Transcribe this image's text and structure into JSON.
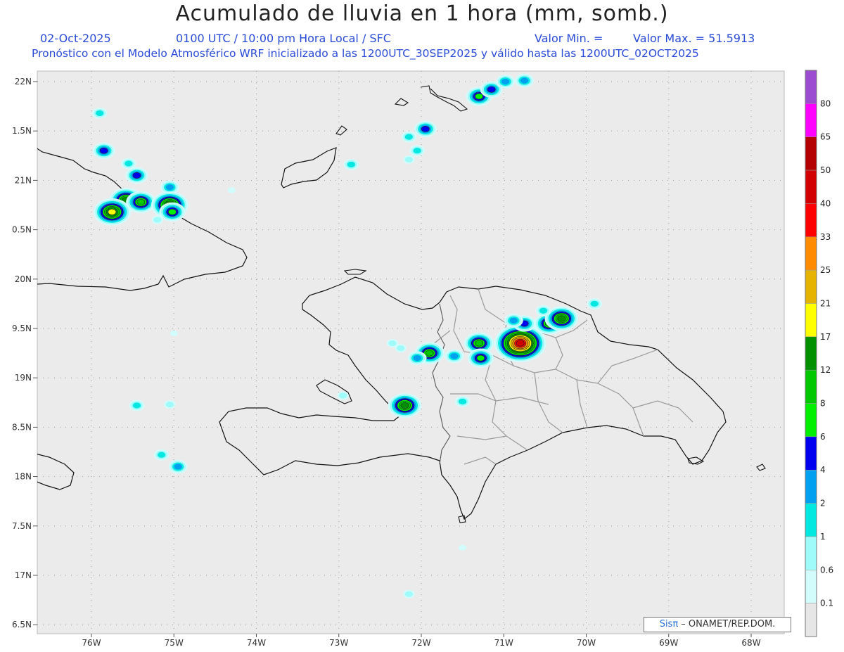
{
  "title": "Acumulado de lluvia en 1 hora (mm, somb.)",
  "date": "02-Oct-2025",
  "time_label": "0100 UTC / 10:00 pm Hora Local / SFC",
  "valor_min_label": "Valor Min. =",
  "valor_max_label": "Valor Max. = 51.5913",
  "forecast_line": "Pronóstico con el Modelo Atmosférico WRF inicializado a las 1200UTC_30SEP2025 y válido hasta las  1200UTC_02OCT2025",
  "credit_brand": "Sisπ",
  "credit_text": " – ONAMET/REP.DOM.",
  "lat_labels": [
    {
      "value": 22.0,
      "label": "22N"
    },
    {
      "value": 21.5,
      "label": "1.5N"
    },
    {
      "value": 21.0,
      "label": "21N"
    },
    {
      "value": 20.5,
      "label": "0.5N"
    },
    {
      "value": 20.0,
      "label": "20N"
    },
    {
      "value": 19.5,
      "label": "9.5N"
    },
    {
      "value": 19.0,
      "label": "19N"
    },
    {
      "value": 18.5,
      "label": "8.5N"
    },
    {
      "value": 18.0,
      "label": "18N"
    },
    {
      "value": 17.5,
      "label": "7.5N"
    },
    {
      "value": 17.0,
      "label": "17N"
    },
    {
      "value": 16.5,
      "label": "6.5N"
    }
  ],
  "lon_labels": [
    {
      "value": -76,
      "label": "76W"
    },
    {
      "value": -75,
      "label": "75W"
    },
    {
      "value": -74,
      "label": "74W"
    },
    {
      "value": -73,
      "label": "73W"
    },
    {
      "value": -72,
      "label": "72W"
    },
    {
      "value": -71,
      "label": "71W"
    },
    {
      "value": -70,
      "label": "70W"
    },
    {
      "value": -69,
      "label": "69W"
    },
    {
      "value": -68,
      "label": "68W"
    }
  ],
  "colorbar": [
    {
      "label": "",
      "color": "#e6e6e6"
    },
    {
      "label": "0.1",
      "color": "#d2fcfc"
    },
    {
      "label": "0.6",
      "color": "#9ffafa"
    },
    {
      "label": "1",
      "color": "#00e8e0"
    },
    {
      "label": "2",
      "color": "#00a0f0"
    },
    {
      "label": "4",
      "color": "#0000f0"
    },
    {
      "label": "6",
      "color": "#00f000"
    },
    {
      "label": "8",
      "color": "#00c800"
    },
    {
      "label": "12",
      "color": "#009000"
    },
    {
      "label": "17",
      "color": "#ffff00"
    },
    {
      "label": "21",
      "color": "#e6b400"
    },
    {
      "label": "25",
      "color": "#ff8c00"
    },
    {
      "label": "33",
      "color": "#ff0000"
    },
    {
      "label": "40",
      "color": "#d20000"
    },
    {
      "label": "50",
      "color": "#b40000"
    },
    {
      "label": "65",
      "color": "#ff00ff"
    },
    {
      "label": "80",
      "color": "#9c4cd0"
    }
  ],
  "colors": {
    "sea": "#ebebeb",
    "coast": "#111111",
    "borders": "#9a9a9a",
    "subtitle": "#2a4bd7"
  },
  "rain_cells": [
    {
      "lon": -75.9,
      "lat": 21.68,
      "level": 3
    },
    {
      "lon": -75.85,
      "lat": 21.3,
      "level": 5
    },
    {
      "lon": -75.55,
      "lat": 21.17,
      "level": 3
    },
    {
      "lon": -75.45,
      "lat": 21.05,
      "level": 5
    },
    {
      "lon": -75.58,
      "lat": 20.8,
      "level": 8
    },
    {
      "lon": -75.75,
      "lat": 20.68,
      "level": 9
    },
    {
      "lon": -75.4,
      "lat": 20.78,
      "level": 7
    },
    {
      "lon": -75.05,
      "lat": 20.93,
      "level": 4
    },
    {
      "lon": -75.05,
      "lat": 20.75,
      "level": 9
    },
    {
      "lon": -75.02,
      "lat": 20.68,
      "level": 6
    },
    {
      "lon": -75.2,
      "lat": 20.6,
      "level": 2
    },
    {
      "lon": -74.3,
      "lat": 20.9,
      "level": 1
    },
    {
      "lon": -71.3,
      "lat": 21.85,
      "level": 6
    },
    {
      "lon": -71.15,
      "lat": 21.92,
      "level": 5
    },
    {
      "lon": -70.98,
      "lat": 22.0,
      "level": 4
    },
    {
      "lon": -70.75,
      "lat": 22.01,
      "level": 4
    },
    {
      "lon": -71.95,
      "lat": 21.52,
      "level": 5
    },
    {
      "lon": -72.15,
      "lat": 21.44,
      "level": 3
    },
    {
      "lon": -72.05,
      "lat": 21.3,
      "level": 3
    },
    {
      "lon": -72.15,
      "lat": 21.21,
      "level": 2
    },
    {
      "lon": -72.85,
      "lat": 21.16,
      "level": 3
    },
    {
      "lon": -71.3,
      "lat": 19.35,
      "level": 7
    },
    {
      "lon": -71.28,
      "lat": 19.2,
      "level": 6
    },
    {
      "lon": -70.8,
      "lat": 19.35,
      "level": 13
    },
    {
      "lon": -70.75,
      "lat": 19.55,
      "level": 5
    },
    {
      "lon": -70.88,
      "lat": 19.58,
      "level": 4
    },
    {
      "lon": -70.45,
      "lat": 19.55,
      "level": 7
    },
    {
      "lon": -70.3,
      "lat": 19.6,
      "level": 8
    },
    {
      "lon": -70.52,
      "lat": 19.68,
      "level": 3
    },
    {
      "lon": -69.9,
      "lat": 19.75,
      "level": 3
    },
    {
      "lon": -71.9,
      "lat": 19.25,
      "level": 7
    },
    {
      "lon": -72.05,
      "lat": 19.2,
      "level": 4
    },
    {
      "lon": -71.6,
      "lat": 19.22,
      "level": 4
    },
    {
      "lon": -72.2,
      "lat": 18.72,
      "level": 8
    },
    {
      "lon": -72.35,
      "lat": 19.35,
      "level": 2
    },
    {
      "lon": -72.25,
      "lat": 19.3,
      "level": 2
    },
    {
      "lon": -71.5,
      "lat": 18.76,
      "level": 3
    },
    {
      "lon": -72.95,
      "lat": 18.82,
      "level": 2
    },
    {
      "lon": -75.45,
      "lat": 18.72,
      "level": 3
    },
    {
      "lon": -75.05,
      "lat": 18.73,
      "level": 2
    },
    {
      "lon": -74.95,
      "lat": 18.1,
      "level": 4
    },
    {
      "lon": -75.15,
      "lat": 18.22,
      "level": 3
    },
    {
      "lon": -72.15,
      "lat": 16.81,
      "level": 2
    },
    {
      "lon": -71.5,
      "lat": 17.28,
      "level": 1
    },
    {
      "lon": -75.0,
      "lat": 19.45,
      "level": 1
    }
  ]
}
